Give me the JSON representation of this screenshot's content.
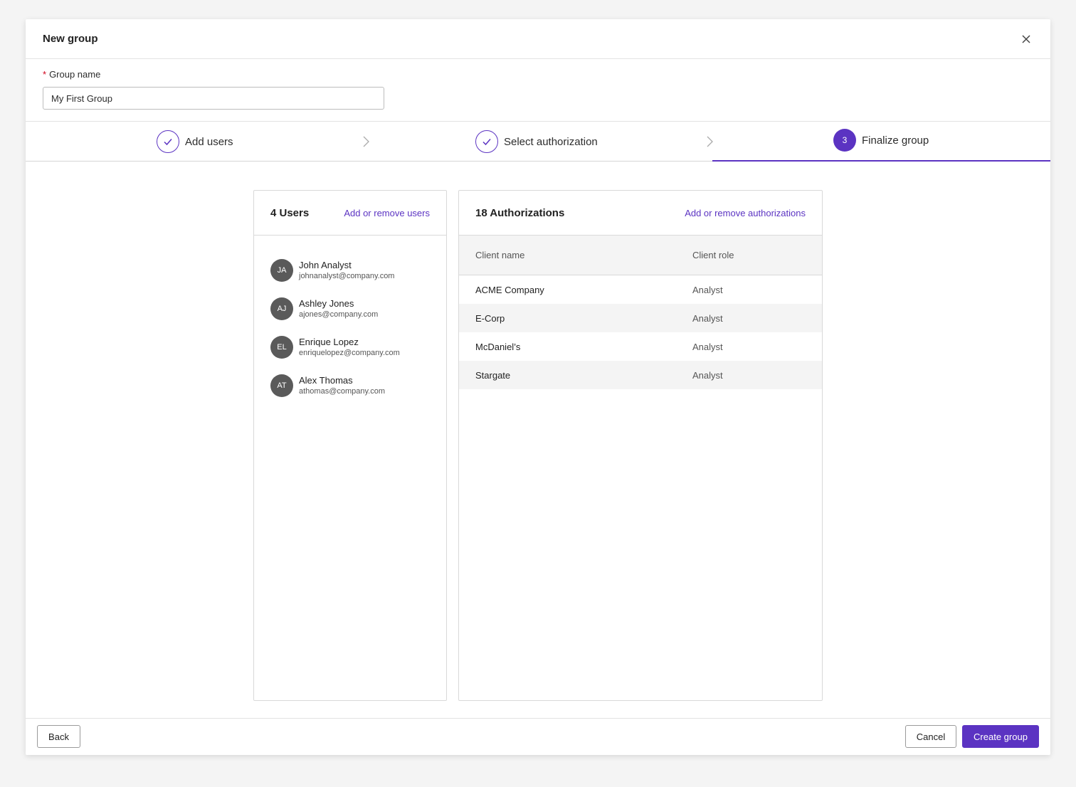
{
  "modal": {
    "title": "New group",
    "close_icon": "close-icon"
  },
  "group_name": {
    "required_mark": "*",
    "label": "Group name",
    "value": "My First Group"
  },
  "stepper": {
    "steps": [
      {
        "label": "Add users",
        "state": "complete"
      },
      {
        "label": "Select authorization",
        "state": "complete"
      },
      {
        "label": "Finalize group",
        "state": "active",
        "number": "3"
      }
    ]
  },
  "users_panel": {
    "title": "4 Users",
    "link": "Add or remove users",
    "users": [
      {
        "initials": "JA",
        "name": "John Analyst",
        "email": "johnanalyst@company.com"
      },
      {
        "initials": "AJ",
        "name": "Ashley Jones",
        "email": "ajones@company.com"
      },
      {
        "initials": "EL",
        "name": "Enrique Lopez",
        "email": "enriquelopez@company.com"
      },
      {
        "initials": "AT",
        "name": "Alex Thomas",
        "email": "athomas@company.com"
      }
    ]
  },
  "auth_panel": {
    "title": "18 Authorizations",
    "link": "Add or remove authorizations",
    "columns": [
      "Client name",
      "Client role"
    ],
    "rows": [
      {
        "client": "ACME Company",
        "role": "Analyst"
      },
      {
        "client": "E-Corp",
        "role": "Analyst"
      },
      {
        "client": "McDaniel’s",
        "role": "Analyst"
      },
      {
        "client": "Stargate",
        "role": "Analyst"
      }
    ]
  },
  "footer": {
    "back_label": "Back",
    "cancel_label": "Cancel",
    "create_label": "Create group"
  },
  "colors": {
    "accent": "#5b33c2",
    "avatar": "#5a5a5a",
    "required": "#d0021b"
  }
}
